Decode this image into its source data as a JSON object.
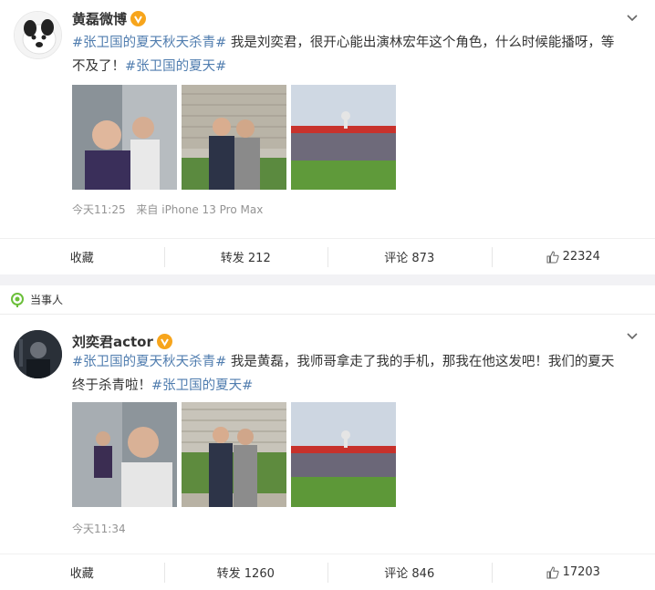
{
  "posts": [
    {
      "author": "黄磊微博",
      "tag1": "#张卫国的夏天秋天杀青#",
      "text1": " 我是刘奕君，很开心能出演林宏年这个角色，什么时候能播呀，等不及了！",
      "tag2": "#张卫国的夏天#",
      "time": "今天11:25",
      "source": "来自 iPhone 13 Pro Max",
      "actions": {
        "collect": "收藏",
        "repost": "转发 212",
        "comment": "评论 873",
        "likes": "22324"
      }
    },
    {
      "author": "刘奕君actor",
      "tag1": "#张卫国的夏天秋天杀青#",
      "text1": " 我是黄磊，我师哥拿走了我的手机，那我在他这发吧！我们的夏天终于杀青啦！",
      "tag2": "#张卫国的夏天#",
      "time": "今天11:34",
      "source": "",
      "actions": {
        "collect": "收藏",
        "repost": "转发 1260",
        "comment": "评论 846",
        "likes": "17203"
      }
    }
  ],
  "party_label": "当事人",
  "colors": {
    "link": "#507daf",
    "badge": "#f7a51c",
    "meta": "#939393"
  },
  "icons": [
    "chevron-down-icon",
    "verified-badge-icon",
    "like-thumb-icon",
    "party-leaf-icon"
  ]
}
